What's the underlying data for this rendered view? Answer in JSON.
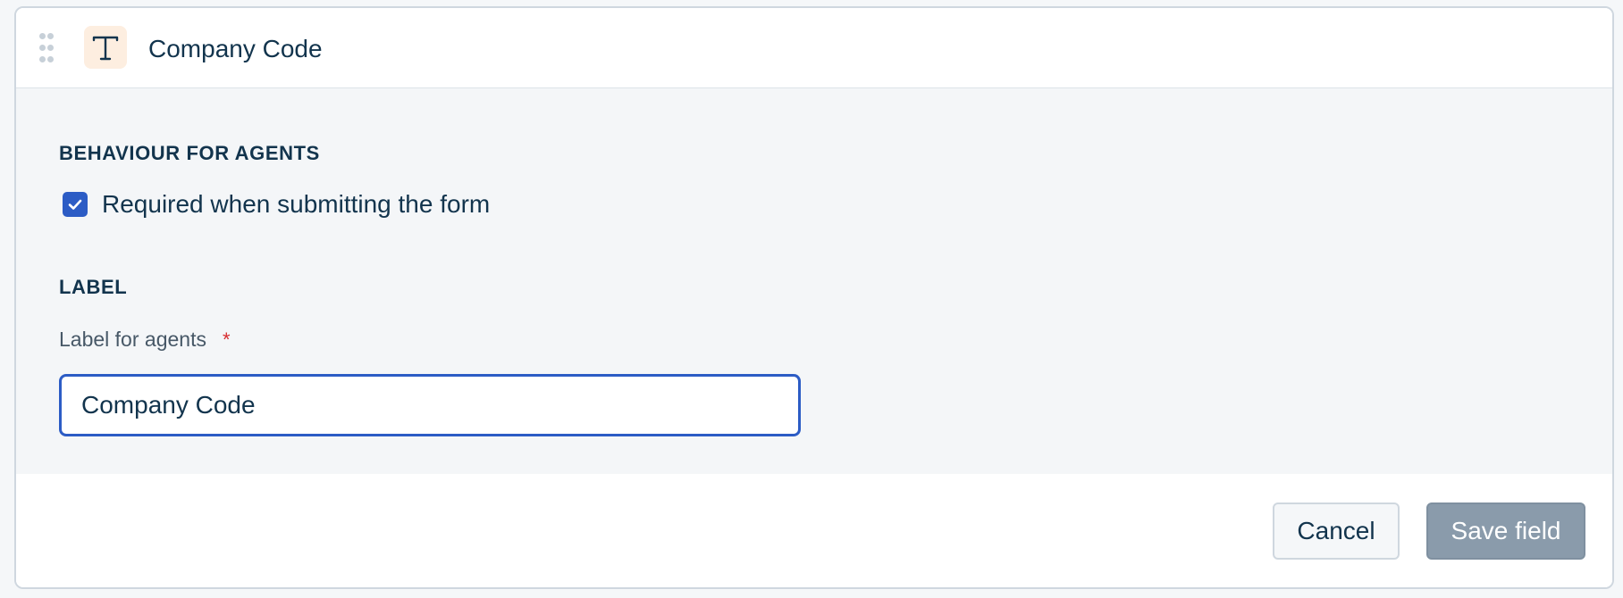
{
  "header": {
    "field_name": "Company Code",
    "type_icon": "text-type-icon",
    "drag_icon": "drag-handle-icon",
    "icon_bg_color": "#fdeee0"
  },
  "behaviour": {
    "heading": "BEHAVIOUR FOR AGENTS",
    "required_label": "Required when submitting the form",
    "required_checked": true
  },
  "label_section": {
    "heading": "LABEL",
    "field_label": "Label for agents",
    "required_marker": "*",
    "input_value": "Company Code"
  },
  "footer": {
    "cancel_label": "Cancel",
    "save_label": "Save field"
  },
  "colors": {
    "accent": "#2c5cc5",
    "required": "#d72d30",
    "save_disabled": "#8a9bab"
  }
}
